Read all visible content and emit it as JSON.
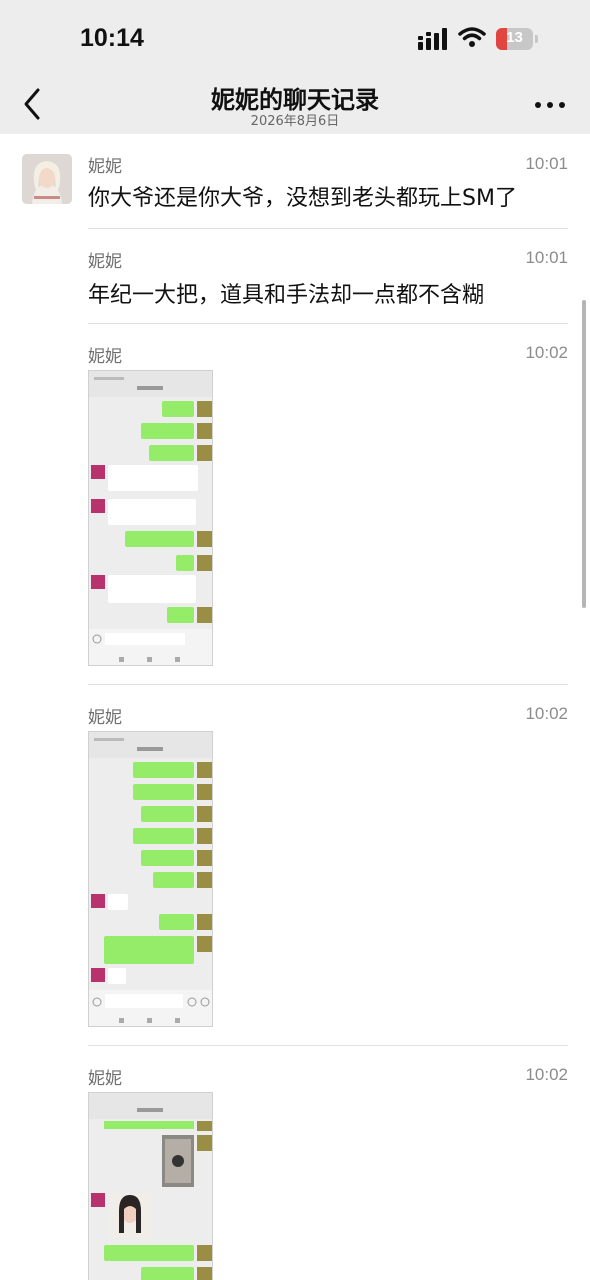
{
  "status": {
    "time": "10:14",
    "battery": "13"
  },
  "nav": {
    "title": "妮妮的聊天记录",
    "date": "2026年8月6日"
  },
  "messages": [
    {
      "name": "妮妮",
      "time": "10:01",
      "text": "你大爷还是你大爷，没想到老头都玩上SM了"
    },
    {
      "name": "妮妮",
      "time": "10:01",
      "text": "年纪一大把，道具和手法却一点都不含糊"
    },
    {
      "name": "妮妮",
      "time": "10:02"
    },
    {
      "name": "妮妮",
      "time": "10:02"
    },
    {
      "name": "妮妮",
      "time": "10:02"
    }
  ],
  "colors": {
    "nav_bg": "#ededed",
    "bubble_green": "#95ec69",
    "battery_red": "#e0453f"
  },
  "icons": [
    "back-chevron-icon",
    "more-dots-icon",
    "signal-icon",
    "wifi-icon",
    "battery-icon",
    "avatar",
    "image-thumbnail"
  ]
}
